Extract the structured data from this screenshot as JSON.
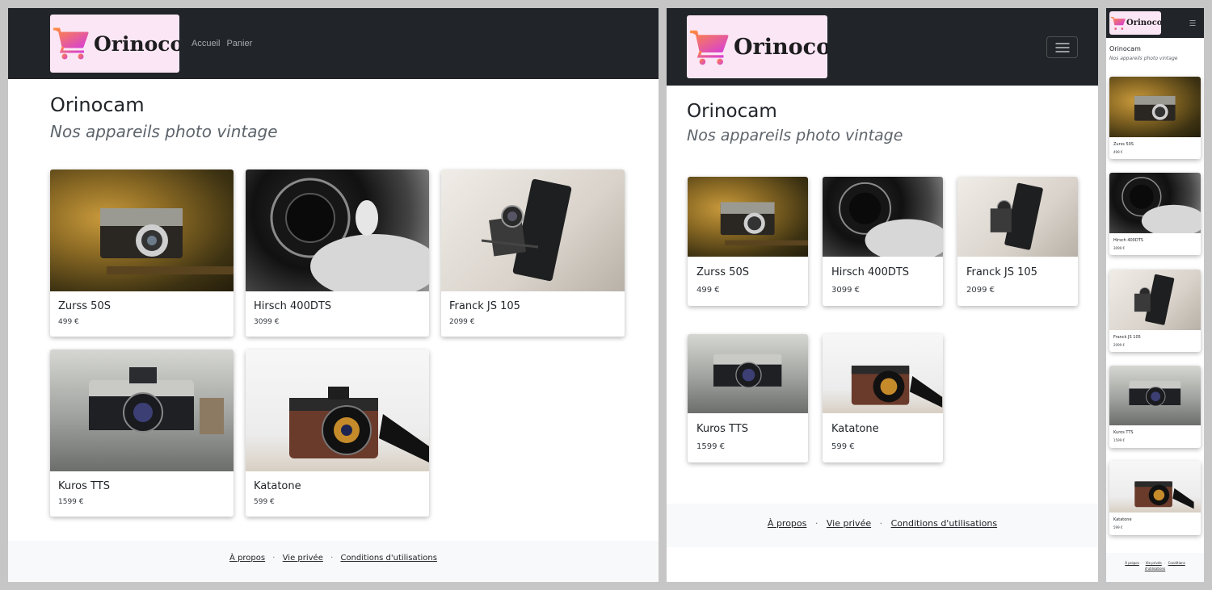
{
  "brand": {
    "name": "Orinoco",
    "logo_bg": "#fbe6f5",
    "cart_gradient": [
      "#ff8a3d",
      "#d63fd6"
    ]
  },
  "nav": {
    "links": [
      "Accueil",
      "Panier"
    ],
    "toggler_icon": "hamburger-icon"
  },
  "hero": {
    "title": "Orinocam",
    "subtitle": "Nos appareils photo vintage"
  },
  "products": [
    {
      "name": "Zurss 50S",
      "price": "499 €",
      "photo": "rangefinder-camera-warm"
    },
    {
      "name": "Hirsch 400DTS",
      "price": "3099 €",
      "photo": "lens-black-white"
    },
    {
      "name": "Franck JS 105",
      "price": "2099 €",
      "photo": "folding-camera"
    },
    {
      "name": "Kuros TTS",
      "price": "1599 €",
      "photo": "slr-camera-grey"
    },
    {
      "name": "Katatone",
      "price": "599 €",
      "photo": "brown-camera-white"
    }
  ],
  "footer": {
    "links": [
      "À propos",
      "Vie privée",
      "Conditions d'utilisations"
    ],
    "separator": "·"
  },
  "colors": {
    "navbar": "#212529",
    "footer": "#f8f9fa",
    "page": "#ffffff",
    "outer": "#c6c6c6"
  }
}
